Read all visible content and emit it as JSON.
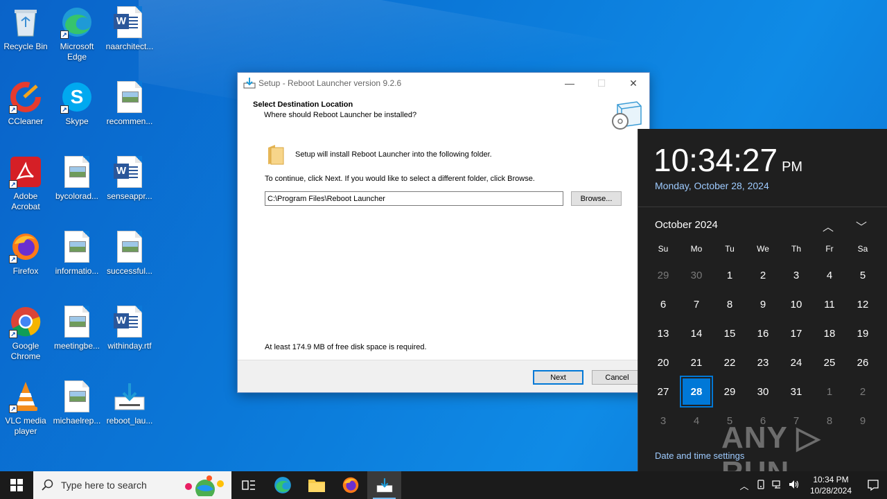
{
  "desktop": {
    "icons": [
      {
        "label": "Recycle Bin"
      },
      {
        "label": "Microsoft Edge"
      },
      {
        "label": "naarchitect..."
      },
      {
        "label": "CCleaner"
      },
      {
        "label": "Skype"
      },
      {
        "label": "recommen..."
      },
      {
        "label": "Adobe Acrobat"
      },
      {
        "label": "bycolorad..."
      },
      {
        "label": "senseappr..."
      },
      {
        "label": "Firefox"
      },
      {
        "label": "informatio..."
      },
      {
        "label": "successful..."
      },
      {
        "label": "Google Chrome"
      },
      {
        "label": "meetingbe..."
      },
      {
        "label": "withinday.rtf"
      },
      {
        "label": "VLC media player"
      },
      {
        "label": "michaelrep..."
      },
      {
        "label": "reboot_lau..."
      }
    ]
  },
  "dialog": {
    "title": "Setup - Reboot Launcher version 9.2.6",
    "minimize": "—",
    "maximize": "☐",
    "close": "✕",
    "heading": "Select Destination Location",
    "subheading": "Where should Reboot Launcher be installed?",
    "info": "Setup will install Reboot Launcher into the following folder.",
    "instruction": "To continue, click Next. If you would like to select a different folder, click Browse.",
    "path_value": "C:\\Program Files\\Reboot Launcher",
    "browse_label": "Browse...",
    "space_required": "At least 174.9 MB of free disk space is required.",
    "next_label": "Next",
    "cancel_label": "Cancel"
  },
  "flyout": {
    "time": "10:34:27",
    "ampm": "PM",
    "date": "Monday, October 28, 2024",
    "month": "October 2024",
    "nav_up": "︿",
    "nav_down": "﹀",
    "weekdays": [
      "Su",
      "Mo",
      "Tu",
      "We",
      "Th",
      "Fr",
      "Sa"
    ],
    "days": [
      {
        "d": "29",
        "muted": true
      },
      {
        "d": "30",
        "muted": true
      },
      {
        "d": "1"
      },
      {
        "d": "2"
      },
      {
        "d": "3"
      },
      {
        "d": "4"
      },
      {
        "d": "5"
      },
      {
        "d": "6"
      },
      {
        "d": "7"
      },
      {
        "d": "8"
      },
      {
        "d": "9"
      },
      {
        "d": "10"
      },
      {
        "d": "11"
      },
      {
        "d": "12"
      },
      {
        "d": "13"
      },
      {
        "d": "14"
      },
      {
        "d": "15"
      },
      {
        "d": "16"
      },
      {
        "d": "17"
      },
      {
        "d": "18"
      },
      {
        "d": "19"
      },
      {
        "d": "20"
      },
      {
        "d": "21"
      },
      {
        "d": "22"
      },
      {
        "d": "23"
      },
      {
        "d": "24"
      },
      {
        "d": "25"
      },
      {
        "d": "26"
      },
      {
        "d": "27"
      },
      {
        "d": "28",
        "today": true
      },
      {
        "d": "29"
      },
      {
        "d": "30"
      },
      {
        "d": "31"
      },
      {
        "d": "1",
        "muted": true
      },
      {
        "d": "2",
        "muted": true
      },
      {
        "d": "3",
        "muted": true
      },
      {
        "d": "4",
        "muted": true
      },
      {
        "d": "5",
        "muted": true
      },
      {
        "d": "6",
        "muted": true
      },
      {
        "d": "7",
        "muted": true
      },
      {
        "d": "8",
        "muted": true
      },
      {
        "d": "9",
        "muted": true
      }
    ],
    "settings_link": "Date and time settings",
    "watermark": "ANY ▷ RUN"
  },
  "taskbar": {
    "search_placeholder": "Type here to search",
    "clock_time": "10:34 PM",
    "clock_date": "10/28/2024",
    "tray_chevron": "︿"
  },
  "colors": {
    "accent": "#0078d7",
    "desktop_blue": "#0b78d8",
    "flyout_bg": "#1f1f1f",
    "link_blue": "#9ecbff"
  }
}
